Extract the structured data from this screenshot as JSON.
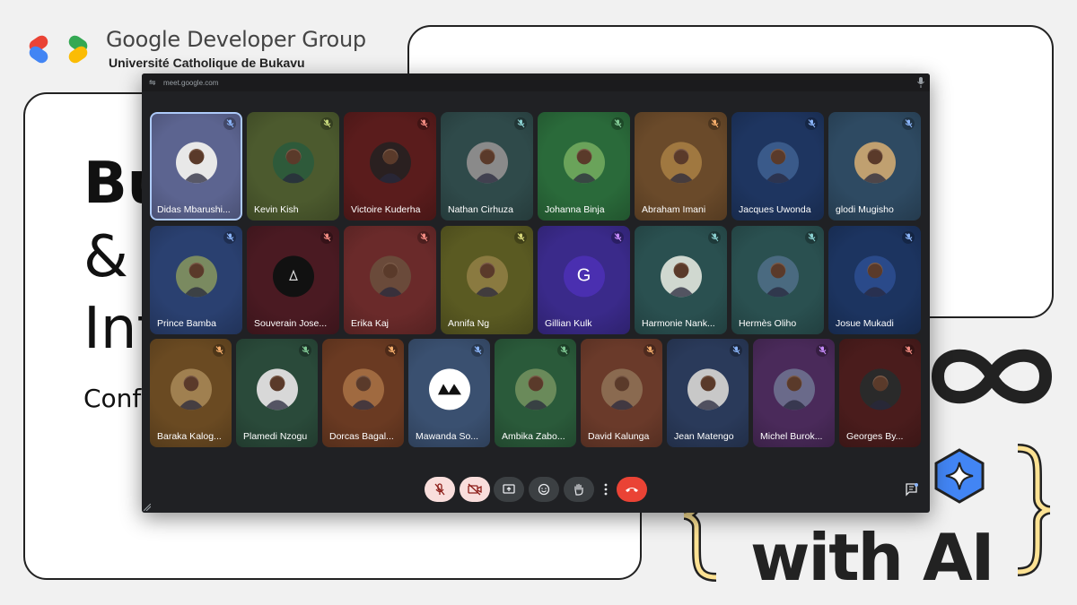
{
  "header": {
    "org_title": "Google Developer Group",
    "org_subtitle": "Université Catholique de Bukavu"
  },
  "slide": {
    "line1": "Bu",
    "line2": "& C",
    "line3": "Int",
    "line4": "Conf",
    "with_ai": "with AI"
  },
  "meet": {
    "url": "meet.google.com",
    "participants": [
      {
        "name": "Didas Mbarushi...",
        "bg": "#5c6490",
        "mute_color": "#8ab4f8",
        "active": true,
        "avatar": "photo",
        "avatar_color": "#e8e8e8"
      },
      {
        "name": "Kevin Kish",
        "bg": "#4c5a2e",
        "mute_color": "#c5d67a",
        "avatar": "photo",
        "avatar_color": "#2e5a3a"
      },
      {
        "name": "Victoire Kuderha",
        "bg": "#5a1c1c",
        "mute_color": "#f28b82",
        "avatar": "photo",
        "avatar_color": "#2a2020"
      },
      {
        "name": "Nathan Cirhuza",
        "bg": "#2f4a4a",
        "mute_color": "#8ad0d0",
        "avatar": "photo",
        "avatar_color": "#8a8a8a"
      },
      {
        "name": "Johanna Binja",
        "bg": "#2a6a3a",
        "mute_color": "#81c995",
        "avatar": "photo",
        "avatar_color": "#6aa35a"
      },
      {
        "name": "Abraham Imani",
        "bg": "#6a4a2a",
        "mute_color": "#f6ae6b",
        "avatar": "photo",
        "avatar_color": "#a07840"
      },
      {
        "name": "Jacques Uwonda",
        "bg": "#1e3560",
        "mute_color": "#8ab4f8",
        "avatar": "photo",
        "avatar_color": "#3a5a8a"
      },
      {
        "name": "glodi Mugisho",
        "bg": "#2e4a62",
        "mute_color": "#8ab4f8",
        "avatar": "photo",
        "avatar_color": "#c0a070"
      },
      {
        "name": "Prince Bamba",
        "bg": "#2a4070",
        "mute_color": "#8ab4f8",
        "avatar": "photo",
        "avatar_color": "#7a8a60"
      },
      {
        "name": "Souverain Jose...",
        "bg": "#4a1a22",
        "mute_color": "#f28b82",
        "avatar": "logo",
        "avatar_color": "#111111"
      },
      {
        "name": "Erika Kaj",
        "bg": "#6a2a2a",
        "mute_color": "#f28b82",
        "avatar": "photo",
        "avatar_color": "#6a4a3a"
      },
      {
        "name": "Annifa Ng",
        "bg": "#5a5a22",
        "mute_color": "#d6d67a",
        "avatar": "photo",
        "avatar_color": "#8a7a40"
      },
      {
        "name": "Gillian Kulk",
        "bg": "#3a2a8a",
        "mute_color": "#c58af9",
        "avatar": "letter",
        "letter": "G",
        "avatar_color": "#4a2fb0"
      },
      {
        "name": "Harmonie Nank...",
        "bg": "#2a5050",
        "mute_color": "#8ad0d0",
        "avatar": "photo",
        "avatar_color": "#d0d8d0"
      },
      {
        "name": "Hermès Oliho",
        "bg": "#2a5050",
        "mute_color": "#8ad0d0",
        "avatar": "photo",
        "avatar_color": "#4a6a80"
      },
      {
        "name": "Josue Mukadi",
        "bg": "#1c3460",
        "mute_color": "#8ab4f8",
        "avatar": "photo",
        "avatar_color": "#2a4a8a"
      },
      {
        "name": "Baraka Kalog...",
        "bg": "#6a4a22",
        "mute_color": "#f6ae6b",
        "avatar": "photo",
        "avatar_color": "#a08050"
      },
      {
        "name": "Plamedi Nzogu",
        "bg": "#2a4a3a",
        "mute_color": "#81c995",
        "avatar": "photo",
        "avatar_color": "#d8d8d8"
      },
      {
        "name": "Dorcas Bagal...",
        "bg": "#6a3a22",
        "mute_color": "#f6ae6b",
        "avatar": "photo",
        "avatar_color": "#a06a40"
      },
      {
        "name": "Mawanda So...",
        "bg": "#3a5070",
        "mute_color": "#8ab4f8",
        "avatar": "logo2",
        "avatar_color": "#ffffff"
      },
      {
        "name": "Ambika Zabo...",
        "bg": "#2a5a3a",
        "mute_color": "#81c995",
        "avatar": "photo",
        "avatar_color": "#6a8a5a"
      },
      {
        "name": "David Kalunga",
        "bg": "#6a3a2a",
        "mute_color": "#f6ae6b",
        "avatar": "photo",
        "avatar_color": "#8a6a50"
      },
      {
        "name": "Jean Matengo",
        "bg": "#2a3a5a",
        "mute_color": "#8ab4f8",
        "avatar": "photo",
        "avatar_color": "#c8c8c8"
      },
      {
        "name": "Michel Burok...",
        "bg": "#4a2a5a",
        "mute_color": "#c58af9",
        "avatar": "photo",
        "avatar_color": "#6a6a8a"
      },
      {
        "name": "Georges By...",
        "bg": "#4a1c1c",
        "mute_color": "#f28b82",
        "avatar": "photo",
        "avatar_color": "#2a2a2a"
      }
    ],
    "controls": [
      {
        "id": "mic-button",
        "icon": "mic-off-icon"
      },
      {
        "id": "camera-button",
        "icon": "camera-off-icon"
      },
      {
        "id": "present-button",
        "icon": "present-screen-icon"
      },
      {
        "id": "reactions-button",
        "icon": "emoji-icon"
      },
      {
        "id": "raise-hand-button",
        "icon": "hand-icon"
      },
      {
        "id": "more-options-button",
        "icon": "more-vert-icon"
      },
      {
        "id": "leave-call-button",
        "icon": "call-end-icon"
      }
    ]
  },
  "colors": {
    "meet_bg": "#202124",
    "end_call": "#ea4335",
    "muted_btn": "#f9dedc",
    "active_border": "#aecbfa"
  }
}
